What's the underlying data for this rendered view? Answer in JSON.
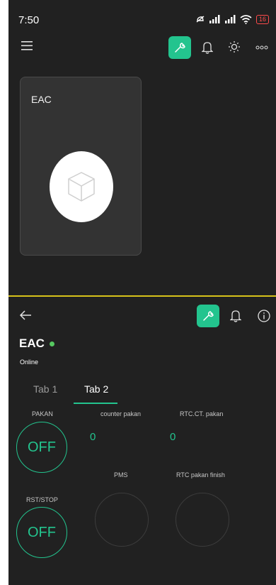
{
  "status_bar": {
    "time": "7:50",
    "battery": "16"
  },
  "home": {
    "icons": [
      "menu-icon",
      "wrench-icon",
      "bell-icon",
      "brightness-icon",
      "more-icon"
    ],
    "device_card": {
      "name": "EAC",
      "icon": "cube-icon"
    }
  },
  "device": {
    "title": "EAC",
    "status": "Online",
    "status_color": "#56c860",
    "accent": "#23c48e",
    "tabs": [
      {
        "label": "Tab 1",
        "active": false
      },
      {
        "label": "Tab 2",
        "active": true
      }
    ],
    "widgets": {
      "pakan": {
        "label": "PAKAN",
        "value": "OFF"
      },
      "counter_pakan": {
        "label": "counter pakan",
        "value": "0"
      },
      "rtc_ct_pakan": {
        "label": "RTC.CT. pakan",
        "value": "0"
      },
      "rst_stop": {
        "label": "RST/STOP",
        "value": "OFF"
      },
      "pms": {
        "label": "PMS"
      },
      "rtc_pakan_finish": {
        "label": "RTC pakan finish"
      }
    }
  }
}
